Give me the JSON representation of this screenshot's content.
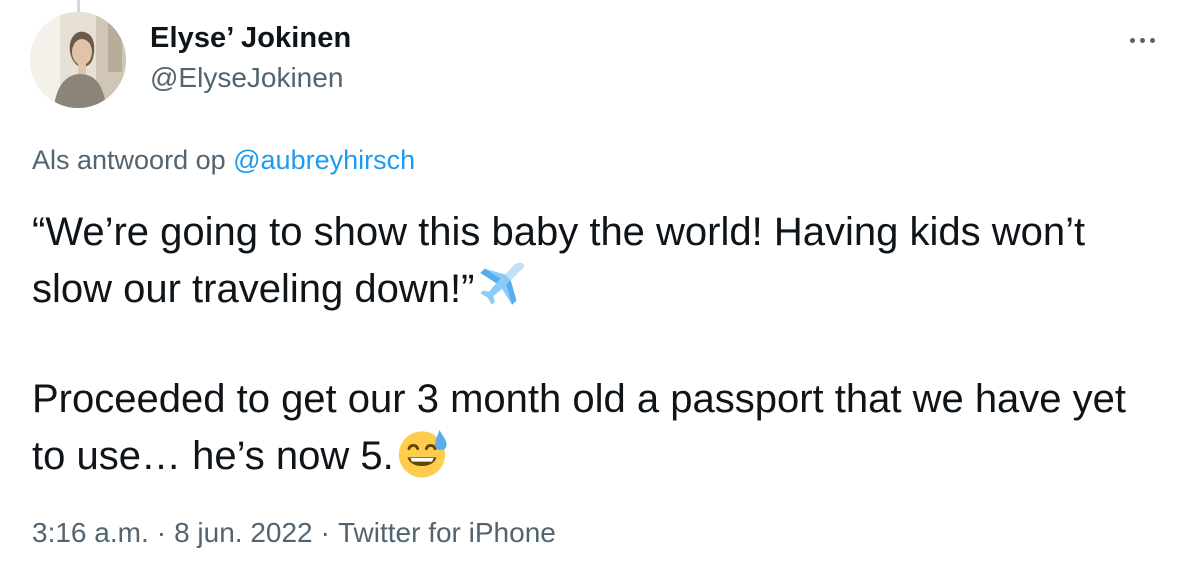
{
  "author": {
    "display_name": "Elyse’ Jokinen",
    "handle": "@ElyseJokinen"
  },
  "reply_context": {
    "prefix": "Als antwoord op ",
    "mention": "@aubreyhirsch"
  },
  "tweet": {
    "paragraph_1": "“We’re going to show this baby the world! Having kids won’t slow our traveling down!”",
    "paragraph_1_emoji": "airplane-emoji",
    "paragraph_2": "Proceeded to get our 3 month old a passport that we have yet to use… he’s now 5.",
    "paragraph_2_emoji": "grinning-face-with-sweat-emoji"
  },
  "meta": {
    "time": "3:16 a.m.",
    "separator": "·",
    "date": "8 jun. 2022",
    "source": "Twitter for iPhone"
  },
  "colors": {
    "text_primary": "#0f1419",
    "text_secondary": "#536471",
    "link": "#1d9bf0"
  },
  "icons": {
    "more": "more-horizontal-icon"
  }
}
